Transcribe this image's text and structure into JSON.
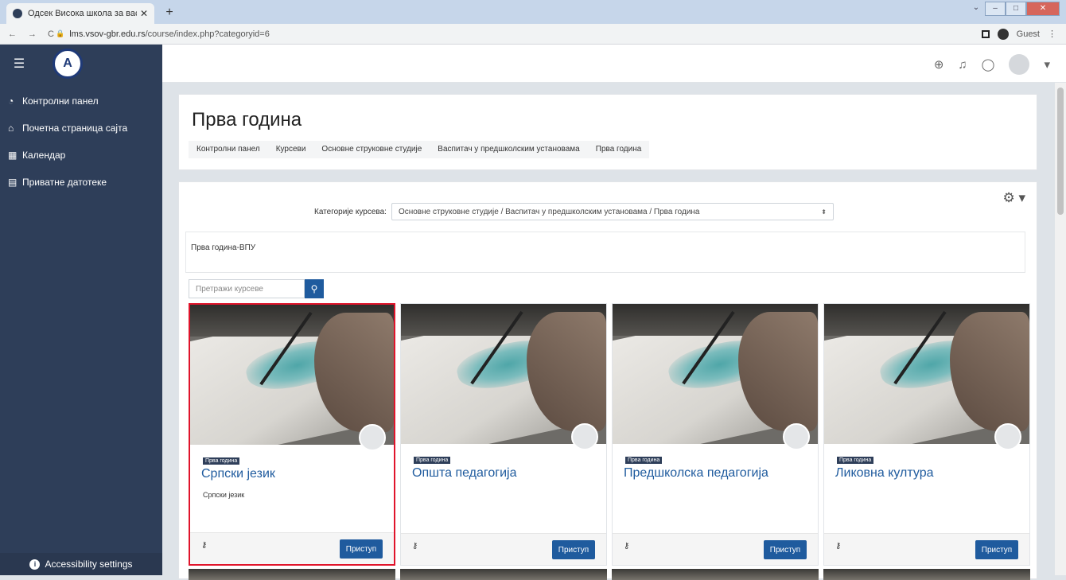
{
  "browser": {
    "tab_title": "Одсек Висока школа за васпит",
    "tab_close": "✕",
    "new_tab": "+",
    "url_host": "lms.vsov-gbr.edu.rs",
    "url_path": "/course/index.php?categoryid=6",
    "guest_label": "Guest"
  },
  "sidebar": {
    "items": [
      {
        "label": "Контролни панел"
      },
      {
        "label": "Почетна страница сајта"
      },
      {
        "label": "Календар"
      },
      {
        "label": "Приватне датотеке"
      }
    ],
    "accessibility": "Accessibility settings"
  },
  "page": {
    "title": "Прва година",
    "breadcrumb": [
      "Контролни панел",
      "Курсеви",
      "Основне струковне студије",
      "Васпитач у предшколским установама",
      "Прва година"
    ]
  },
  "category": {
    "label": "Категорије курсева:",
    "selected": "Основне струковне студије / Васпитач у предшколским установама / Прва година"
  },
  "description": "Прва година-ВПУ",
  "search": {
    "placeholder": "Претражи курсеве"
  },
  "courses": [
    {
      "badge": "Прва година",
      "title": "Српски језик",
      "summary": "Српски језик",
      "button": "Приступ"
    },
    {
      "badge": "Прва година",
      "title": "Општа педагогија",
      "summary": "",
      "button": "Приступ"
    },
    {
      "badge": "Прва година",
      "title": "Предшколска педагогија",
      "summary": "",
      "button": "Приступ"
    },
    {
      "badge": "Прва година",
      "title": "Ликовна култура",
      "summary": "",
      "button": "Приступ"
    }
  ],
  "colors": {
    "sidebar": "#2e3e59",
    "primary": "#1f5b9e",
    "highlight": "#e0142b"
  }
}
